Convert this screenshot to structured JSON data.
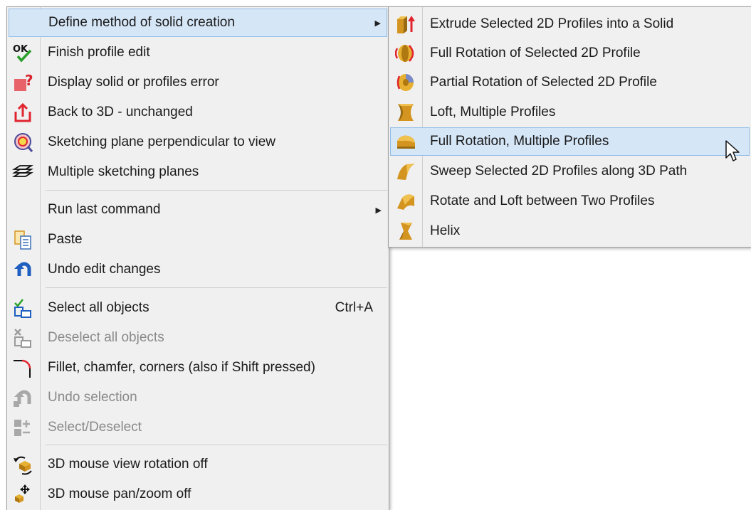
{
  "main_menu": {
    "items": [
      {
        "label": "Define method of solid creation",
        "icon": "define-method-icon",
        "submenu": true
      },
      {
        "label": "Finish profile edit",
        "icon": "ok-check-icon"
      },
      {
        "label": "Display solid or profiles error",
        "icon": "error-question-icon"
      },
      {
        "label": "Back to 3D - unchanged",
        "icon": "back-to-3d-icon"
      },
      {
        "label": "Sketching plane perpendicular to view",
        "icon": "sketch-plane-view-icon"
      },
      {
        "label": "Multiple sketching planes",
        "icon": "multiple-planes-icon"
      },
      {
        "label": "Run last command",
        "icon": "",
        "submenu": true
      },
      {
        "label": "Paste",
        "icon": "paste-icon"
      },
      {
        "label": "Undo edit changes",
        "icon": "undo-icon"
      },
      {
        "label": "Select all objects",
        "icon": "select-all-icon",
        "shortcut": "Ctrl+A"
      },
      {
        "label": "Deselect all objects",
        "icon": "deselect-all-icon",
        "disabled": true
      },
      {
        "label": "Fillet, chamfer, corners (also if Shift pressed)",
        "icon": "fillet-corner-icon"
      },
      {
        "label": "Undo selection",
        "icon": "undo-selection-icon",
        "disabled": true
      },
      {
        "label": "Select/Deselect",
        "icon": "select-deselect-icon",
        "disabled": true
      },
      {
        "label": "3D mouse view rotation off",
        "icon": "mouse-rotation-icon"
      },
      {
        "label": "3D mouse pan/zoom off",
        "icon": "mouse-pan-zoom-icon"
      }
    ]
  },
  "sub_menu": {
    "items": [
      {
        "label": "Extrude Selected 2D Profiles into a Solid",
        "icon": "extrude-icon"
      },
      {
        "label": "Full Rotation of Selected 2D Profile",
        "icon": "full-rotation-icon"
      },
      {
        "label": "Partial Rotation of Selected 2D Profile",
        "icon": "partial-rotation-icon"
      },
      {
        "label": "Loft, Multiple Profiles",
        "icon": "loft-icon"
      },
      {
        "label": "Full Rotation, Multiple Profiles",
        "icon": "full-rotation-multi-icon",
        "highlighted": true
      },
      {
        "label": "Sweep Selected 2D Profiles along 3D Path",
        "icon": "sweep-icon"
      },
      {
        "label": "Rotate and Loft between Two Profiles",
        "icon": "rotate-loft-icon"
      },
      {
        "label": "Helix",
        "icon": "helix-icon"
      }
    ]
  },
  "colors": {
    "menu_bg": "#f0f0f0",
    "highlight_bg": "#d5e6f7",
    "highlight_border": "#92bde8",
    "disabled_text": "#8a8a8a",
    "icon_orange": "#d49520"
  }
}
